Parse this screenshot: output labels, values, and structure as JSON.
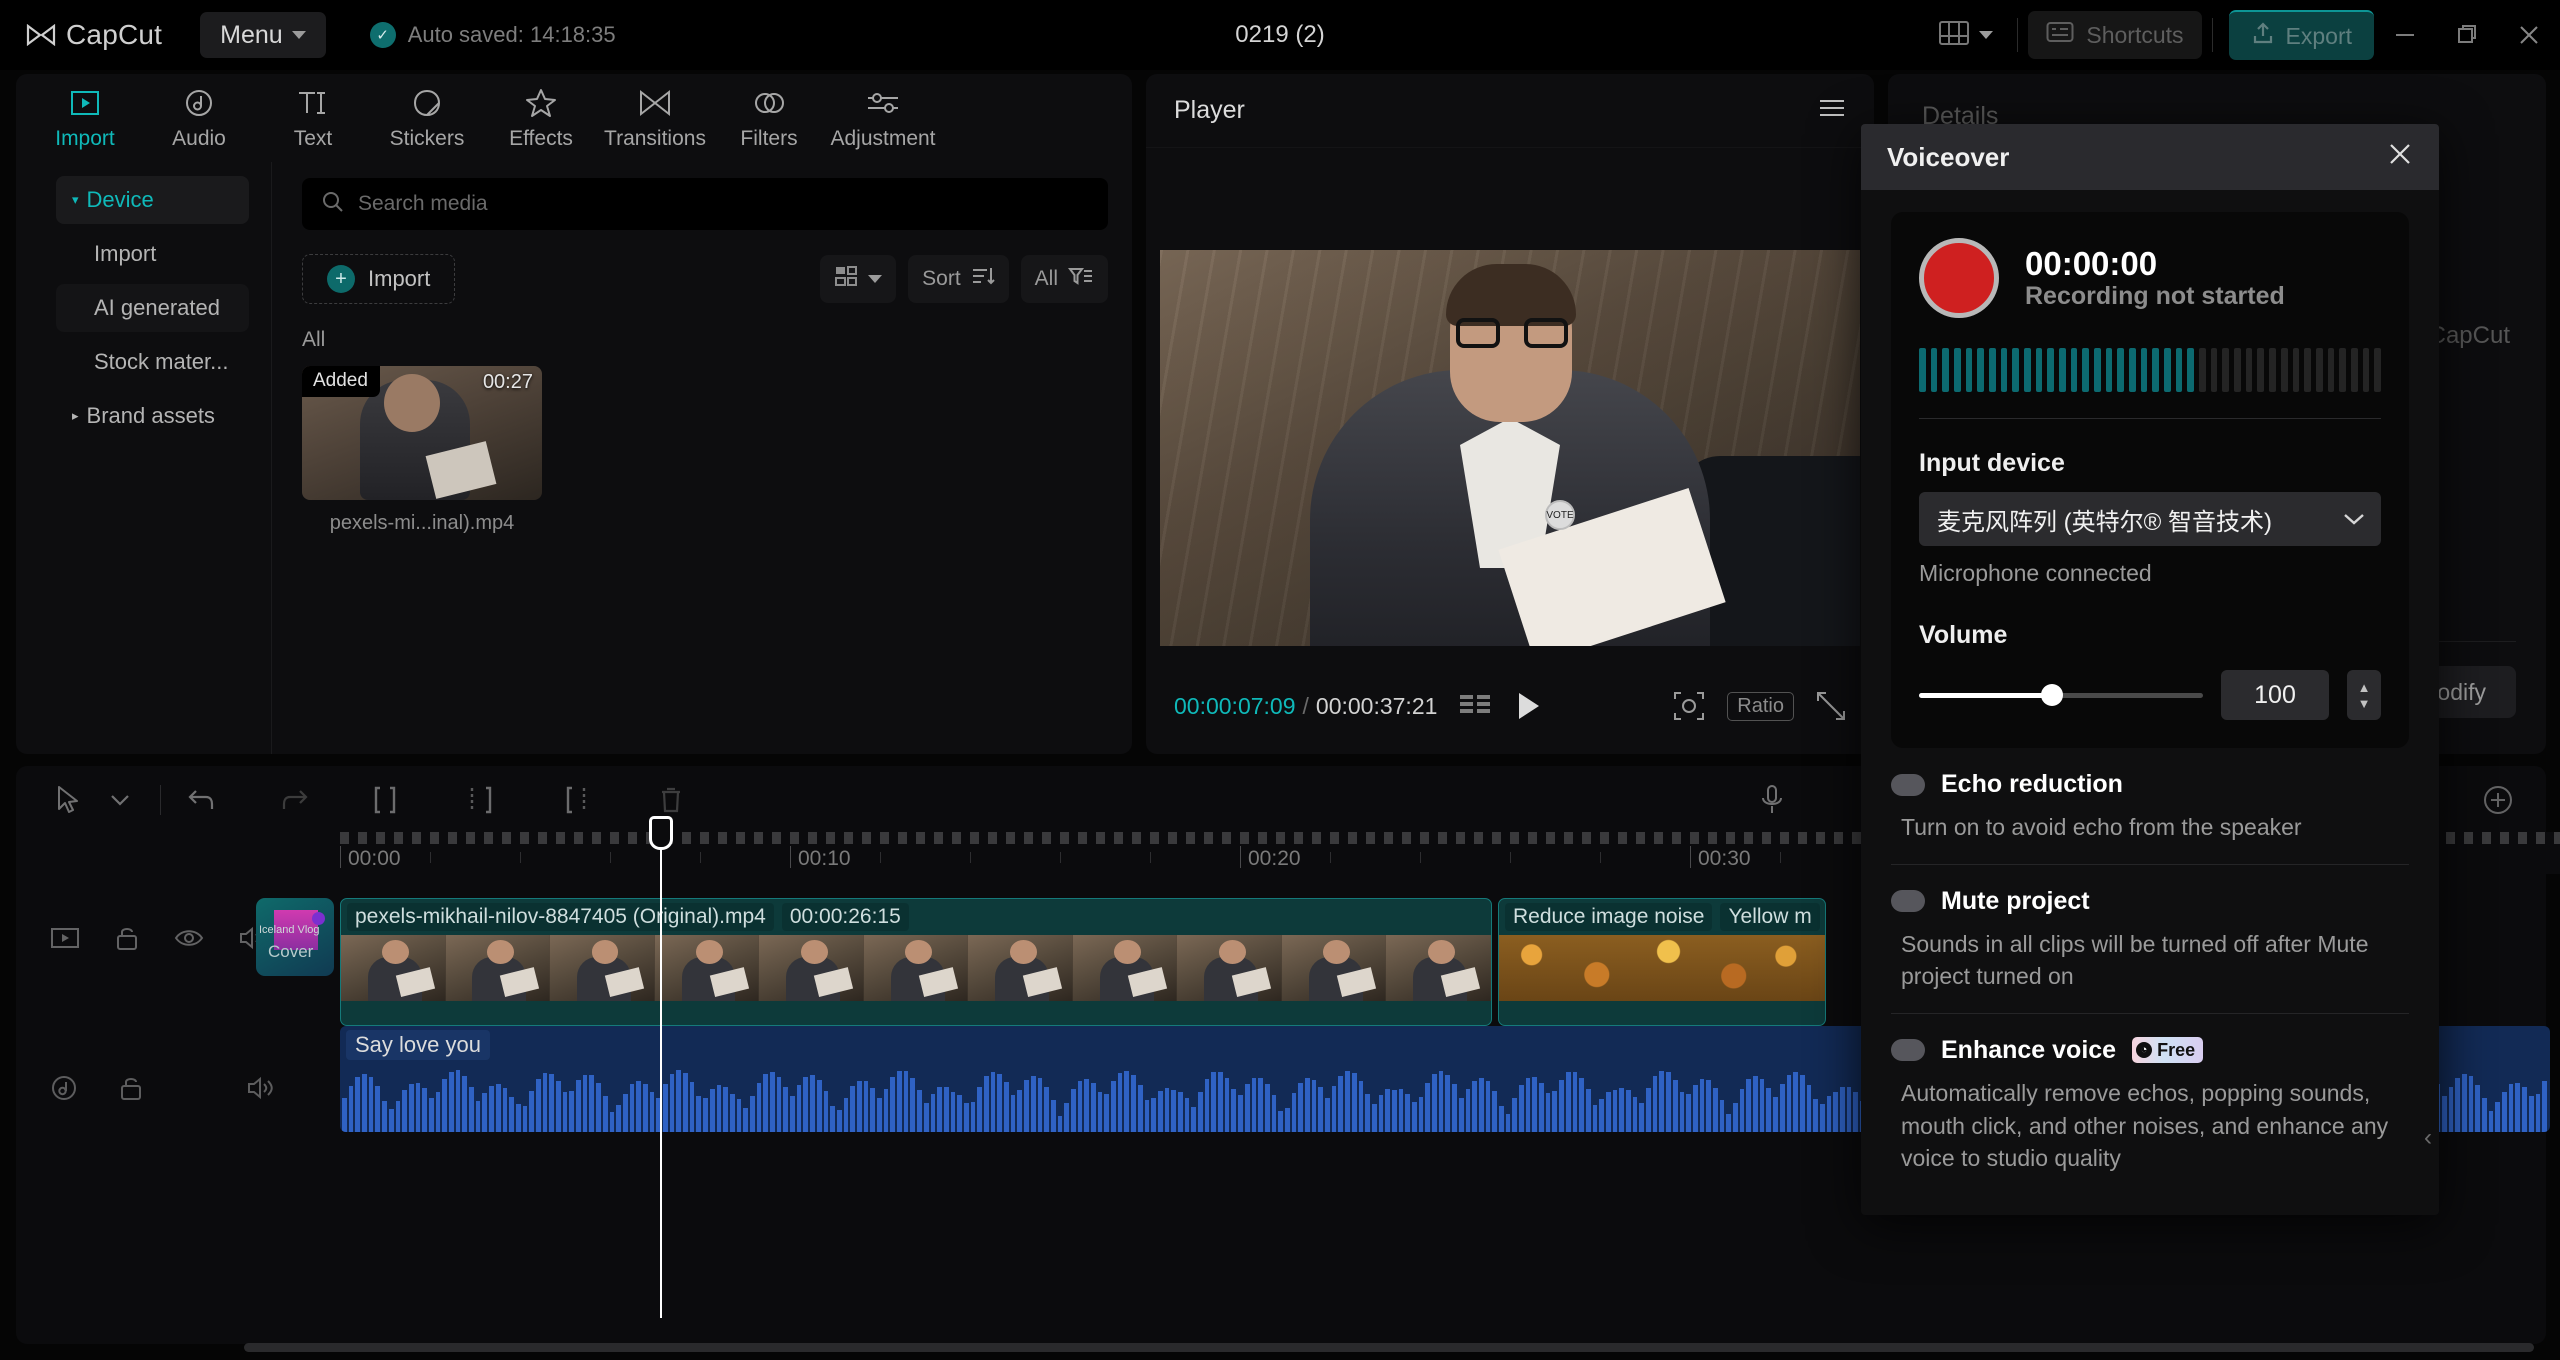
{
  "titlebar": {
    "app_name": "CapCut",
    "menu_label": "Menu",
    "autosave": "Auto saved: 14:18:35",
    "project_title": "0219 (2)",
    "shortcuts_label": "Shortcuts",
    "export_label": "Export",
    "accent": "#0fb9b9"
  },
  "left_panel": {
    "tabs": [
      {
        "label": "Import",
        "icon": "import-icon",
        "active": true
      },
      {
        "label": "Audio",
        "icon": "audio-note-icon",
        "active": false
      },
      {
        "label": "Text",
        "icon": "text-ti-icon",
        "active": false
      },
      {
        "label": "Stickers",
        "icon": "sticker-icon",
        "active": false
      },
      {
        "label": "Effects",
        "icon": "star-effects-icon",
        "active": false
      },
      {
        "label": "Transitions",
        "icon": "transition-icon",
        "active": false
      },
      {
        "label": "Filters",
        "icon": "filter-icon",
        "active": false
      },
      {
        "label": "Adjustment",
        "icon": "sliders-icon",
        "active": false
      }
    ],
    "subnav": [
      {
        "label": "Device",
        "type": "group",
        "expanded": true
      },
      {
        "label": "Import",
        "type": "item"
      },
      {
        "label": "AI generated",
        "type": "item"
      },
      {
        "label": "Stock mater...",
        "type": "item"
      },
      {
        "label": "Brand assets",
        "type": "group",
        "expanded": false
      }
    ],
    "search_placeholder": "Search media",
    "search_value": "",
    "import_label": "Import",
    "view_mode": "grid",
    "sort_label": "Sort",
    "filter_label": "All",
    "section_label": "All",
    "media": [
      {
        "name": "pexels-mi...inal).mp4",
        "duration": "00:27",
        "badge": "Added"
      }
    ]
  },
  "player": {
    "title": "Player",
    "current_time": "00:00:07:09",
    "total_time": "00:00:37:21",
    "ratio_label": "Ratio"
  },
  "details": {
    "title": "Details",
    "brand": "CapCut",
    "modify_label": "Modify"
  },
  "voiceover": {
    "title": "Voiceover",
    "timer": "00:00:00",
    "status": "Recording not started",
    "meter_total": 40,
    "meter_active": 24,
    "input_device_label": "Input device",
    "input_device_value": "麦克风阵列 (英特尔® 智音技术)",
    "device_status": "Microphone connected",
    "volume_label": "Volume",
    "volume_value": "100",
    "volume_percent": 47,
    "options": [
      {
        "title": "Echo reduction",
        "desc": "Turn on to avoid echo from the speaker",
        "enabled": false,
        "badge": null
      },
      {
        "title": "Mute project",
        "desc": "Sounds in all clips will be turned off after Mute project turned on",
        "enabled": false,
        "badge": null
      },
      {
        "title": "Enhance voice",
        "desc": "Automatically remove echos, popping sounds, mouth click, and other noises, and enhance any voice to studio quality",
        "enabled": false,
        "badge": "Free"
      }
    ]
  },
  "timeline": {
    "toolbar_icons": [
      "select-arrow-icon",
      "chevron-down-icon",
      "undo-icon",
      "redo-icon",
      "split-icon",
      "trim-left-icon",
      "trim-right-icon",
      "delete-icon",
      "mic-voiceover-icon",
      "add-track-icon"
    ],
    "ruler_labels": [
      "00:00",
      "00:10",
      "00:20",
      "00:30"
    ],
    "video_track": {
      "controls": [
        "video-track-icon",
        "lock-icon",
        "eye-icon",
        "volume-icon"
      ],
      "cover_label_1": "Iceland Vlog",
      "cover_label_2": "Cover",
      "clips": [
        {
          "name": "pexels-mikhail-nilov-8847405 (Original).mp4",
          "duration": "00:00:26:15"
        },
        {
          "name": "Reduce image noise",
          "extra": "Yellow m"
        }
      ]
    },
    "audio_track": {
      "controls": [
        "audio-track-icon",
        "lock-icon",
        "volume-icon"
      ],
      "clip_name": "Say love you"
    }
  }
}
